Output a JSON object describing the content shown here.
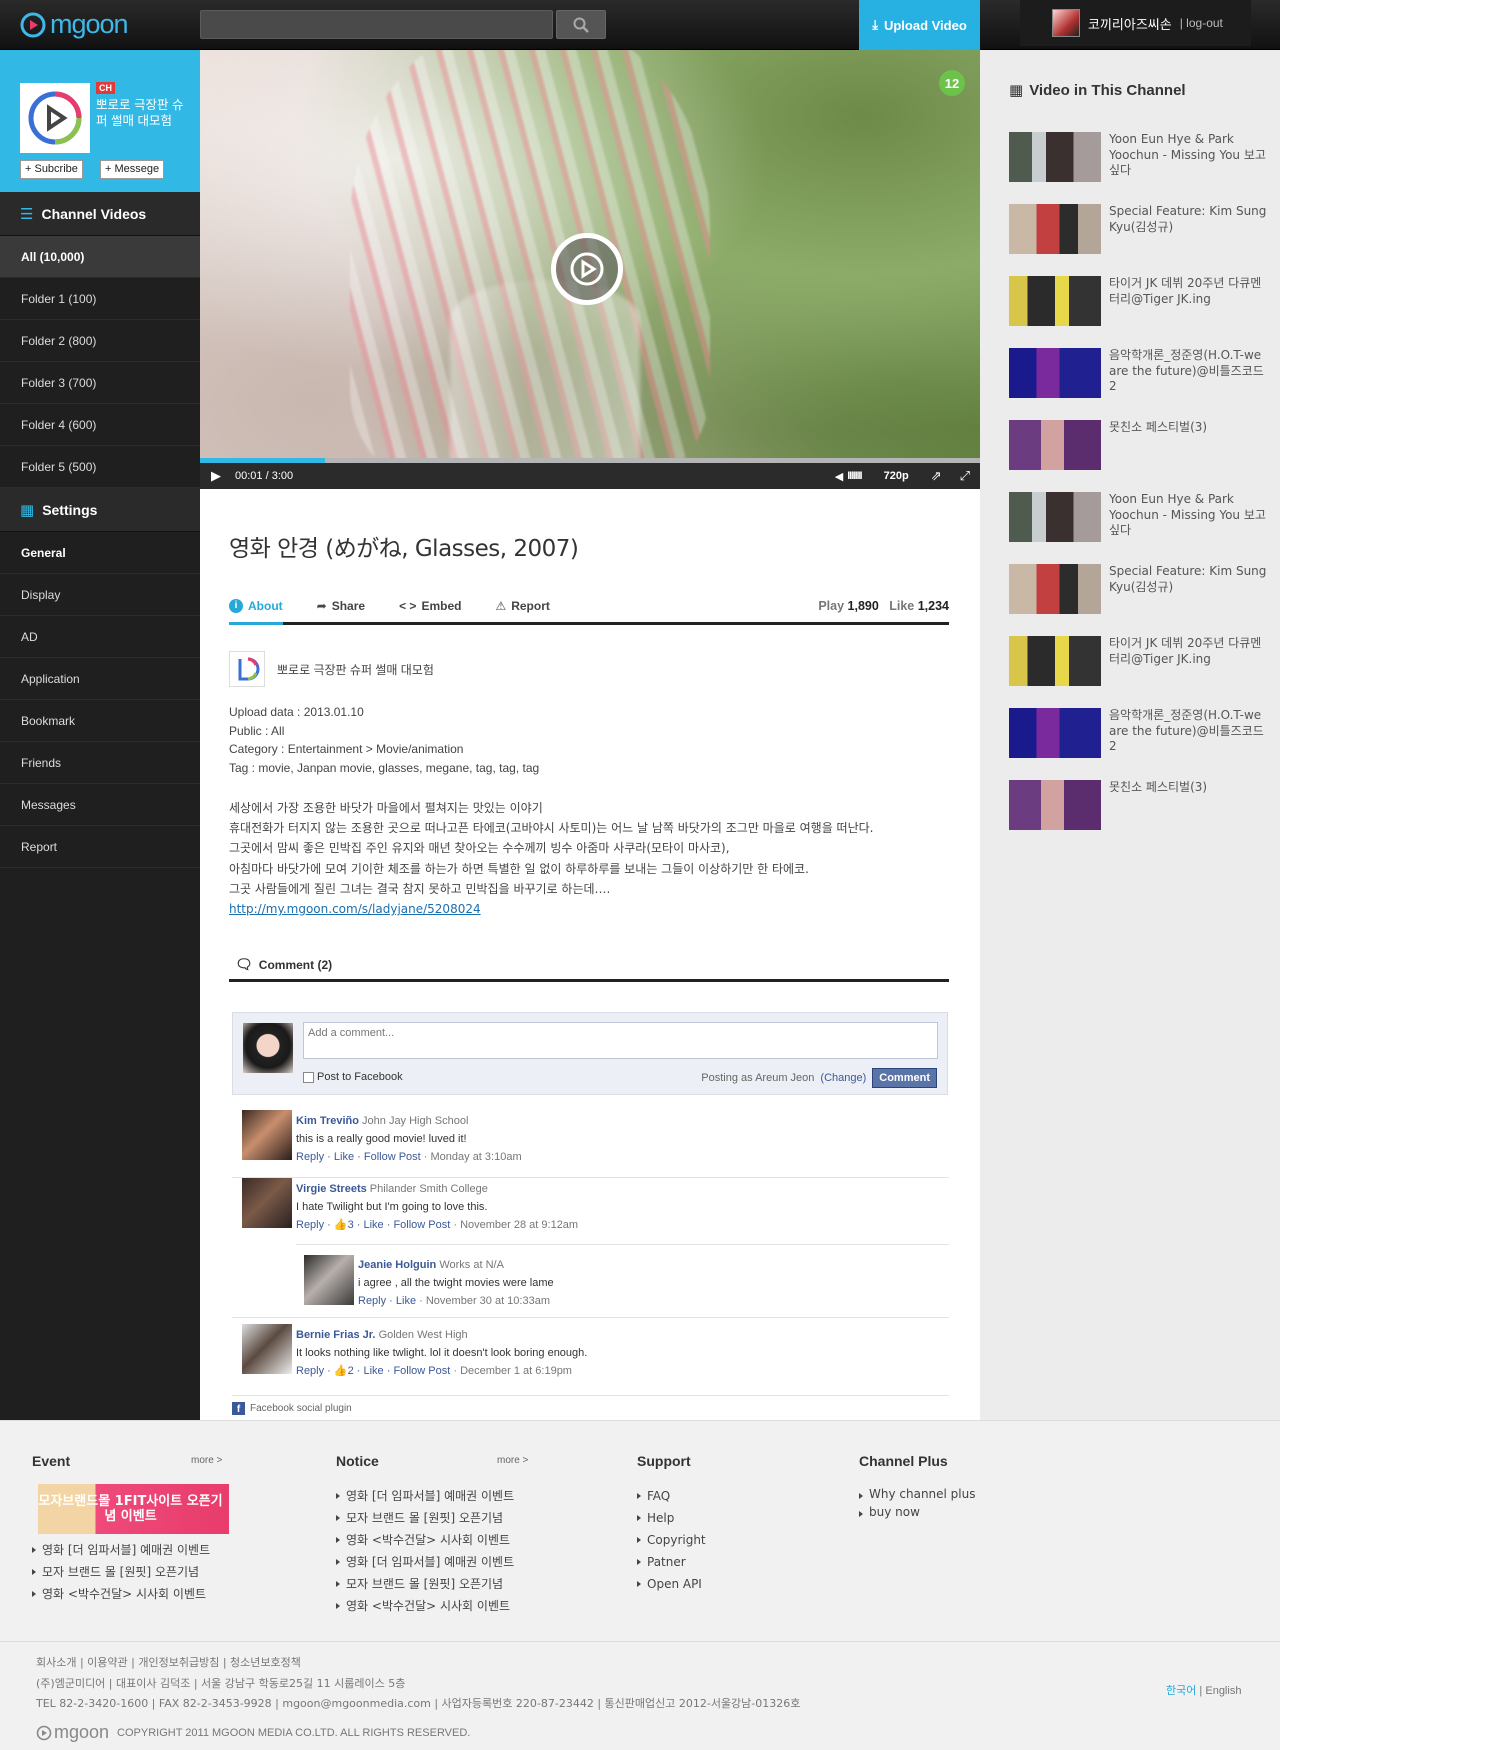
{
  "header": {
    "logo": "mgoon",
    "upload_label": "Upload Video",
    "username": "코끼리아즈씨손",
    "logout_label": "| log-out"
  },
  "channel": {
    "badge": "CH",
    "name": "뽀로로 극장판 슈퍼 썰매 대모험",
    "subscribe_label": "+ Subcribe",
    "message_label": "+ Messege"
  },
  "sidebar": {
    "channel_videos_label": "Channel Videos",
    "folders": [
      "All  (10,000)",
      "Folder 1 (100)",
      "Folder 2 (800)",
      "Folder 3 (700)",
      "Folder 4 (600)",
      "Folder 5 (500)"
    ],
    "settings_label": "Settings",
    "settings_items": [
      "General",
      "Display",
      "AD",
      "Application",
      "Bookmark",
      "Friends",
      "Messages",
      "Report"
    ]
  },
  "player": {
    "badge_count": "12",
    "time": "00:01 / 3:00",
    "quality": "720p",
    "progress": 0.16,
    "volume_bars": "IIIIIII"
  },
  "video": {
    "title": "영화 안경 (めがね, Glasses, 2007)",
    "tabs": [
      "About",
      "Share",
      "Embed",
      "Report"
    ],
    "play_label": "Play",
    "play_count": "1,890",
    "like_label": "Like",
    "like_count": "1,234",
    "author": "뽀로로 극장판 슈퍼 썰매 대모험",
    "upload_data": "Upload data : 2013.01.10",
    "public": "Public : All",
    "category": "Category : Entertainment > Movie/animation",
    "tags": "Tag : movie, Janpan movie, glasses, megane, tag, tag, tag",
    "description": [
      "세상에서 가장 조용한 바닷가 마을에서 펼쳐지는 맛있는 이야기",
      "휴대전화가 터지지 않는 조용한 곳으로 떠나고픈 타에코(고바야시 사토미)는 어느 날 남쪽 바닷가의 조그만 마을로 여행을 떠난다.",
      "그곳에서 맘씨 좋은 민박집 주인 유지와 매년 찾아오는 수수께끼 빙수 아줌마 사쿠라(모타이 마사코),",
      "아침마다 바닷가에 모여 기이한 체조를 하는가 하면 특별한 일 없이 하루하루를 보내는 그들이 이상하기만 한 타에코.",
      "그곳 사람들에게 질린 그녀는 결국 참지 못하고 민박집을 바꾸기로 하는데…."
    ],
    "link": "http://my.mgoon.com/s/ladyjane/5208024"
  },
  "comments": {
    "header": "Comment (2)",
    "placeholder": "Add a comment...",
    "post_to_fb": "Post to Facebook",
    "posting_as": "Posting as Areum Jeon",
    "change": "(Change)",
    "button": "Comment",
    "plugin": "Facebook social plugin",
    "items": [
      {
        "name": "Kim Treviño",
        "aff": "John Jay High School",
        "text": "this is a really good movie! luved it!",
        "actions": "Reply · Like · Follow Post",
        "time": "· Monday at 3:10am"
      },
      {
        "name": "Virgie Streets",
        "aff": "Philander Smith College",
        "text": "I hate Twilight but I'm going to love this.",
        "actions": "Reply · 👍3 · Like · Follow Post",
        "time": "· November 28 at 9:12am"
      },
      {
        "name": "Jeanie Holguin",
        "aff": "Works at N/A",
        "text": "i agree , all the twight movies were lame",
        "actions": "Reply · Like",
        "time": "· November 30 at 10:33am"
      },
      {
        "name": "Bernie Frias Jr.",
        "aff": "Golden West High",
        "text": "It looks nothing like twlight. lol it doesn't look boring enough.",
        "actions": "Reply · 👍2 · Like · Follow Post",
        "time": "· December 1 at 6:19pm"
      }
    ]
  },
  "right": {
    "heading": "Video in This Channel",
    "videos": [
      "Yoon Eun Hye & Park Yoochun - Missing You 보고싶다",
      "Special Feature: Kim Sung Kyu(김성규)",
      "타이거 JK 데뷔 20주년 다큐멘터리@Tiger JK.ing",
      "음악학개론_정준영(H.O.T-we are the future)@비틀즈코드2",
      "못친소 페스티벌(3)",
      "Yoon Eun Hye & Park Yoochun - Missing You 보고싶다",
      "Special Feature: Kim Sung Kyu(김성규)",
      "타이거 JK 데뷔 20주년 다큐멘터리@Tiger JK.ing",
      "음악학개론_정준영(H.O.T-we are the future)@비틀즈코드2",
      "못친소 페스티벌(3)"
    ]
  },
  "footer": {
    "event": {
      "title": "Event",
      "more": "more >",
      "banner": "모자브랜드몰 1FIT사이트 오픈기념 이벤트",
      "items": [
        "영화 [더 임파서블] 예매권 이벤트",
        "모자 브랜드 몰 [원핏] 오픈기념",
        "영화 <박수건달> 시사회 이벤트"
      ]
    },
    "notice": {
      "title": "Notice",
      "more": "more >",
      "items": [
        "영화 [더 임파서블] 예매권 이벤트",
        "모자 브랜드 몰 [원핏] 오픈기념",
        "영화 <박수건달> 시사회 이벤트",
        "영화 [더 임파서블] 예매권 이벤트",
        "모자 브랜드 몰 [원핏] 오픈기념",
        "영화 <박수건달> 시사회 이벤트"
      ]
    },
    "support": {
      "title": "Support",
      "items": [
        "FAQ",
        "Help",
        "Copyright",
        "Patner",
        "Open API"
      ]
    },
    "channel_plus": {
      "title": "Channel Plus",
      "items": [
        "Why channel plus",
        "buy now"
      ]
    },
    "links": "회사소개 | 이용약관 | 개인정보취급방침 | 청소년보호정책",
    "address": "(주)엠군미디어  |  대표이사 김덕조  |  서울 강남구 학동로25길 11 시룹레이스 5층",
    "contact": "TEL 82-2-3420-1600  |  FAX 82-2-3453-9928  |  mgoon@mgoonmedia.com  |  사업자등록번호 220-87-23442  |  통신판매업신고 2012-서울강남-01326호",
    "lang_ko": "한국어",
    "lang_sep": " | ",
    "lang_en": "English",
    "copyright": "COPYRIGHT 2011 MGOON MEDIA CO.LTD. ALL RIGHTS RESERVED."
  }
}
